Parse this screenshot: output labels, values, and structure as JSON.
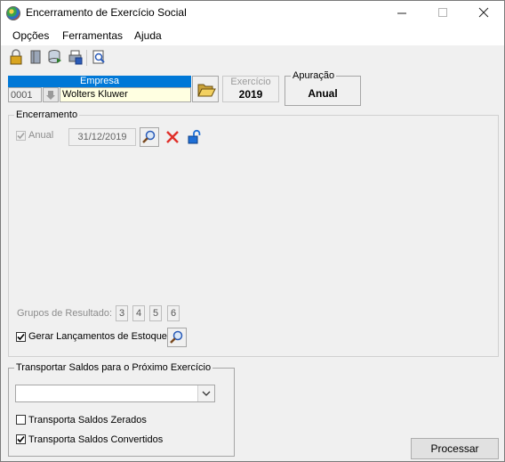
{
  "window": {
    "title": "Encerramento de Exercício Social"
  },
  "menu": [
    "Opções",
    "Ferramentas",
    "Ajuda"
  ],
  "empresa": {
    "label": "Empresa",
    "code": "0001",
    "name": "Wolters Kluwer"
  },
  "exercicio": {
    "label": "Exercício",
    "value": "2019"
  },
  "apuracao": {
    "label": "Apuração",
    "value": "Anual"
  },
  "encerramento": {
    "title": "Encerramento",
    "anual_label": "Anual",
    "date": "31/12/2019"
  },
  "grupos": {
    "label": "Grupos de Resultado:",
    "values": [
      "3",
      "4",
      "5",
      "6"
    ]
  },
  "estoque": {
    "label": "Gerar Lançamentos de Estoque"
  },
  "transportar": {
    "title": "Transportar Saldos para o Próximo Exercício",
    "select_value": "",
    "zerados_label": "Transporta Saldos Zerados",
    "convertidos_label": "Transporta Saldos Convertidos"
  },
  "buttons": {
    "processar": "Processar"
  },
  "colors": {
    "accent": "#0078d7",
    "highlight_field": "#ffffe1"
  }
}
